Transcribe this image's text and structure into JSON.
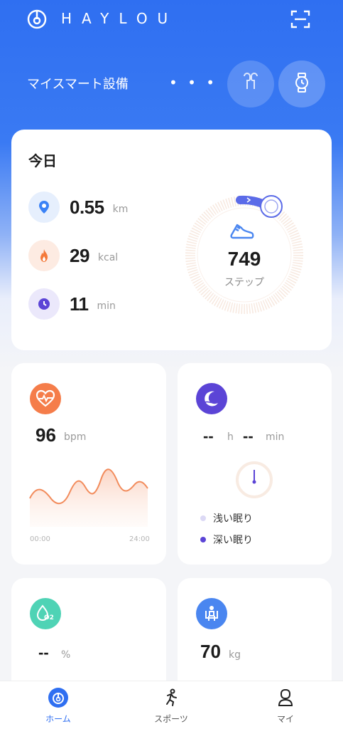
{
  "header": {
    "brand": "HAYLOU",
    "devices_label": "マイスマート設備",
    "more": "• • •"
  },
  "today": {
    "title": "今日",
    "distance": {
      "value": "0.55",
      "unit": "km"
    },
    "calories": {
      "value": "29",
      "unit": "kcal"
    },
    "duration": {
      "value": "11",
      "unit": "min"
    },
    "steps": {
      "value": "749",
      "label": "ステップ"
    }
  },
  "heart_rate": {
    "value": "96",
    "unit": "bpm",
    "axis_start": "00:00",
    "axis_end": "24:00"
  },
  "sleep": {
    "hours": "--",
    "hours_unit": "h",
    "minutes": "--",
    "minutes_unit": "min",
    "legend": [
      {
        "label": "浅い眠り",
        "color": "#dcd9f5"
      },
      {
        "label": "深い眠り",
        "color": "#5b44d6"
      }
    ]
  },
  "oxygen": {
    "value": "--",
    "unit": "%",
    "icon_text": "O2"
  },
  "weight": {
    "value": "70",
    "unit": "kg"
  },
  "nav": {
    "items": [
      {
        "label": "ホーム"
      },
      {
        "label": "スポーツ"
      },
      {
        "label": "マイ"
      }
    ]
  },
  "colors": {
    "primary": "#2f6ff1",
    "distance_icon": "#3b82f6",
    "calories_icon": "#f47a3b",
    "duration_icon": "#5b44d6",
    "heart_icon": "#f57d4a",
    "sleep_icon": "#5b44d6",
    "oxygen_icon": "#4fd3b5",
    "weight_icon": "#4a86f0"
  }
}
